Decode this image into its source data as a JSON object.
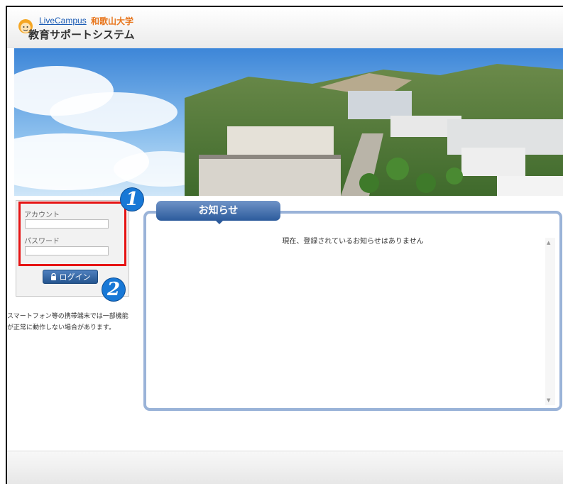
{
  "header": {
    "brand": "LiveCampus",
    "university": "和歌山大学",
    "system_title": "教育サポートシステム"
  },
  "login": {
    "account_label": "アカウント",
    "account_value": "",
    "password_label": "パスワード",
    "password_value": "",
    "button_label": "ログイン"
  },
  "annotations": {
    "step1": "1",
    "step2": "2"
  },
  "note": "スマートフォン等の携帯端末では一部機能が正常に動作しない場合があります。",
  "notice": {
    "tab_label": "お知らせ",
    "empty_message": "現在、登録されているお知らせはありません"
  },
  "colors": {
    "highlight": "#e61414",
    "accent": "#2c5b9c",
    "badge": "#1878d6"
  }
}
